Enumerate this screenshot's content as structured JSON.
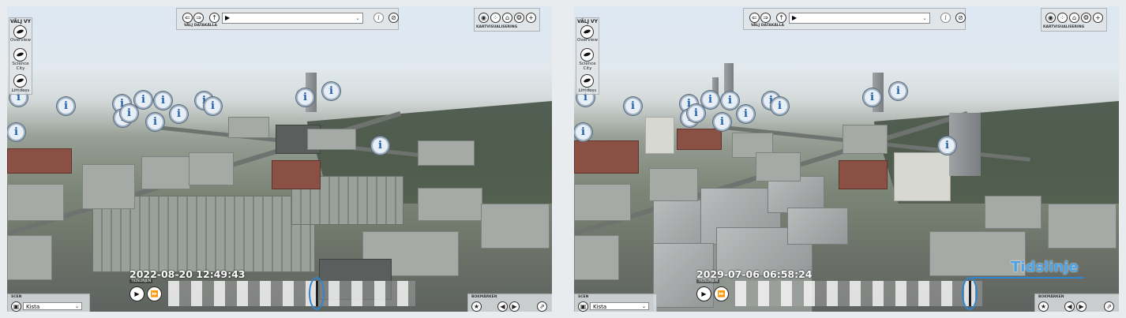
{
  "screens": [
    {
      "id": "before",
      "valj_vy": {
        "title": "VÄLJ VY",
        "items": [
          {
            "label": "Overview",
            "icon": "overview-view-icon"
          },
          {
            "label": "Science City",
            "icon": "science-city-view-icon"
          },
          {
            "label": "Limdess",
            "icon": "limdess-view-icon"
          }
        ]
      },
      "top_bar": {
        "datakalla_label": "VÄLJ DATAKÄLLA",
        "select_value": "▶",
        "select_chevron": "⌄",
        "info_label": "i"
      },
      "kartvisualisering": {
        "label": "KARTVISUALISERING"
      },
      "scene": {
        "title": "SCEN",
        "value": "Kista",
        "chevron": "⌄"
      },
      "bookmarks": {
        "title": "BOKMÄRKEN"
      },
      "timeline": {
        "date": "2022-08-20 12:49:43",
        "label": "TIDSLINJEN",
        "position": 0.6
      }
    },
    {
      "id": "after",
      "valj_vy": {
        "title": "VÄLJ VY",
        "items": [
          {
            "label": "Overview",
            "icon": "overview-view-icon"
          },
          {
            "label": "Science City",
            "icon": "science-city-view-icon"
          },
          {
            "label": "Limdess",
            "icon": "limdess-view-icon"
          }
        ]
      },
      "top_bar": {
        "datakalla_label": "VÄLJ DATAKÄLLA",
        "select_value": "▶",
        "select_chevron": "⌄",
        "info_label": "i"
      },
      "kartvisualisering": {
        "label": "KARTVISUALISERING"
      },
      "scene": {
        "title": "SCEN",
        "value": "Kista",
        "chevron": "⌄"
      },
      "bookmarks": {
        "title": "BOKMÄRKEN"
      },
      "timeline": {
        "date": "2029-07-06 06:58:24",
        "label": "TIDSLINJEN",
        "position": 0.95
      },
      "annotation": {
        "text": "Tidslinje",
        "color": "#4aa3e8"
      }
    }
  ],
  "colors": {
    "accent": "#2f85cf",
    "info_icon": "#1c5fa8"
  },
  "icons": {
    "back": "back-arrow-icon",
    "forward": "forward-arrow-icon",
    "up": "up-arrow-icon",
    "info": "info-icon",
    "compass": "compass-icon",
    "visibility": "eye-icon",
    "grid": "grid-icon",
    "home": "home-icon",
    "settings": "gear-icon",
    "add": "plus-icon",
    "scene": "camera-icon",
    "bookmark_add": "bookmark-star-icon",
    "bookmark_prev": "previous-icon",
    "bookmark_next": "next-icon",
    "bookmark_share": "share-icon",
    "play": "play-icon",
    "fast_forward": "fast-forward-icon",
    "map_marker": "info-marker-icon"
  },
  "glyphs": {
    "back": "⇐",
    "forward": "⇒",
    "up": "↑",
    "compass": "⊘",
    "eye": "◉",
    "grid": "⁘",
    "home": "⌂",
    "gear": "❂",
    "plus": "+",
    "camera": "▣",
    "star": "★",
    "prev": "◀",
    "next": "▶",
    "share": "⇗",
    "play": "▶",
    "ff": "⏩",
    "marker": "i"
  }
}
